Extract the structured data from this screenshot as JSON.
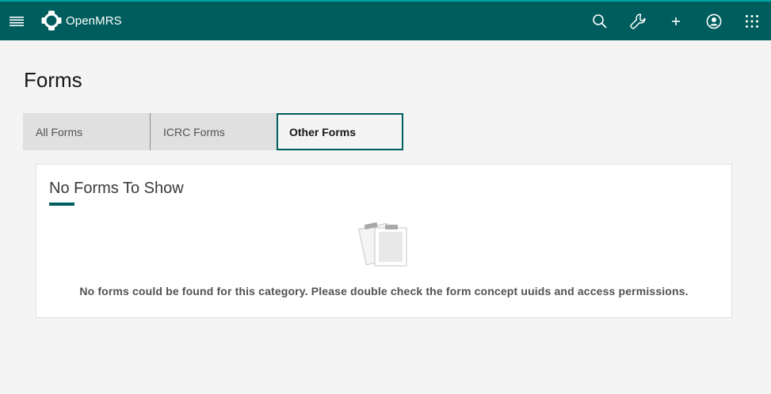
{
  "app": {
    "brand": "OpenMRS",
    "accent_color": "#005d5d",
    "header_icons": [
      "menu-icon",
      "search-icon",
      "wrench-icon",
      "add-icon",
      "user-avatar-icon",
      "app-switcher-icon"
    ]
  },
  "page": {
    "title": "Forms"
  },
  "tabs": [
    {
      "label": "All Forms",
      "selected": false
    },
    {
      "label": "ICRC Forms",
      "selected": false
    },
    {
      "label": "Other Forms",
      "selected": true
    }
  ],
  "empty_state": {
    "heading": "No Forms To Show",
    "icon": "clipboard-stack-icon",
    "message": "No forms could be found for this category. Please double check the form concept uuids and access permissions."
  }
}
